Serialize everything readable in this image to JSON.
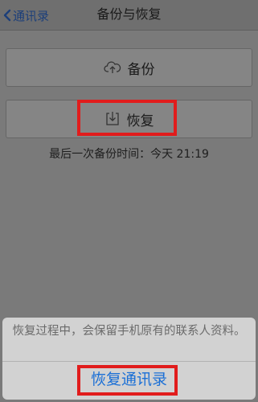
{
  "navbar": {
    "back_label": "通讯录",
    "back_icon": "chevron-left-icon",
    "title": "备份与恢复"
  },
  "buttons": {
    "backup_label": "备份",
    "backup_icon": "cloud-upload-icon",
    "restore_label": "恢复",
    "restore_icon": "download-tray-icon"
  },
  "status": {
    "last_backup_text": "最后一次备份时间：今天 21:19"
  },
  "action_sheet": {
    "message": "恢复过程中，会保留手机原有的联系人资料。",
    "action_label": "恢复通讯录"
  },
  "colors": {
    "link_blue": "#1c3f7a",
    "action_blue": "#1a6fd6",
    "highlight_red": "#e11c1c"
  }
}
